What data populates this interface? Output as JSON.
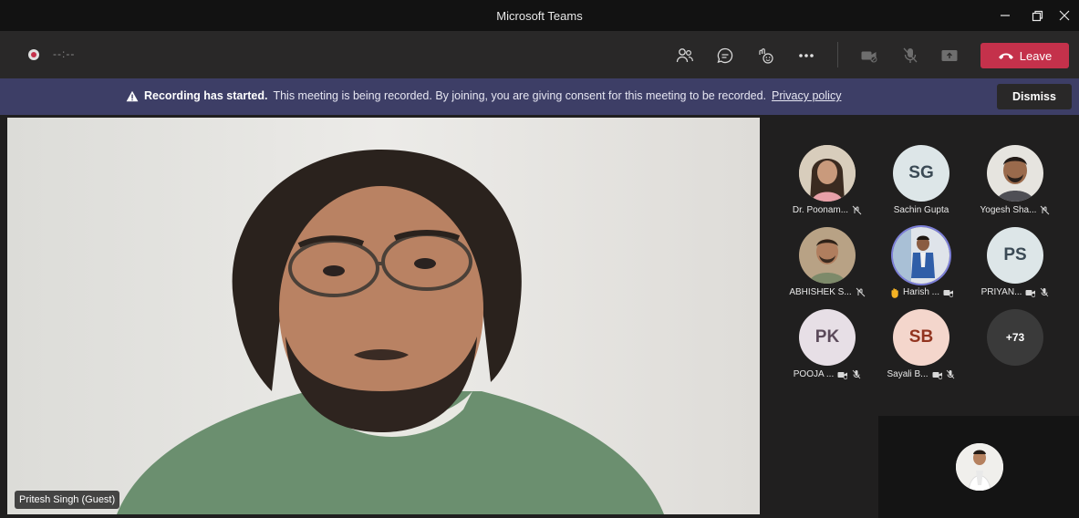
{
  "window": {
    "title": "Microsoft Teams"
  },
  "toolbar": {
    "timer": "--:--",
    "icons": [
      "participants-icon",
      "chat-icon",
      "reactions-icon",
      "more-icon",
      "camera-off-icon",
      "mic-off-icon",
      "share-icon"
    ],
    "leave_label": "Leave"
  },
  "banner": {
    "bold_text": "Recording has started.",
    "text": "This meeting is being recorded. By joining, you are giving consent for this meeting to be recorded.",
    "link_text": "Privacy policy",
    "dismiss_label": "Dismiss"
  },
  "main_video": {
    "name": "Pritesh Singh (Guest)"
  },
  "participants": [
    {
      "name": "Dr. Poonam...",
      "initials": "",
      "photo": true,
      "icons": [
        "hand-muted-icon"
      ]
    },
    {
      "name": "Sachin Gupta",
      "initials": "SG",
      "photo": false,
      "icons": []
    },
    {
      "name": "Yogesh Sha...",
      "initials": "",
      "photo": true,
      "icons": [
        "hand-muted-icon"
      ]
    },
    {
      "name": "ABHISHEK S...",
      "initials": "",
      "photo": true,
      "icons": [
        "hand-muted-icon"
      ]
    },
    {
      "name": "Harish ...",
      "initials": "",
      "photo": true,
      "raised_hand": true,
      "icons": [
        "camera-off-icon"
      ]
    },
    {
      "name": "PRIYAN...",
      "initials": "PS",
      "photo": false,
      "icons": [
        "camera-off-icon",
        "mic-off-icon"
      ]
    },
    {
      "name": "POOJA ...",
      "initials": "PK",
      "photo": false,
      "icons": [
        "camera-off-icon",
        "mic-off-icon"
      ]
    },
    {
      "name": "Sayali B...",
      "initials": "SB",
      "photo": false,
      "icons": [
        "camera-off-icon",
        "mic-off-icon"
      ]
    },
    {
      "name": "",
      "initials": "+73",
      "photo": false,
      "icons": []
    }
  ],
  "colors": {
    "leave": "#c4314b",
    "banner": "#3d3e66",
    "accent_ring": "#7c7fd8"
  }
}
